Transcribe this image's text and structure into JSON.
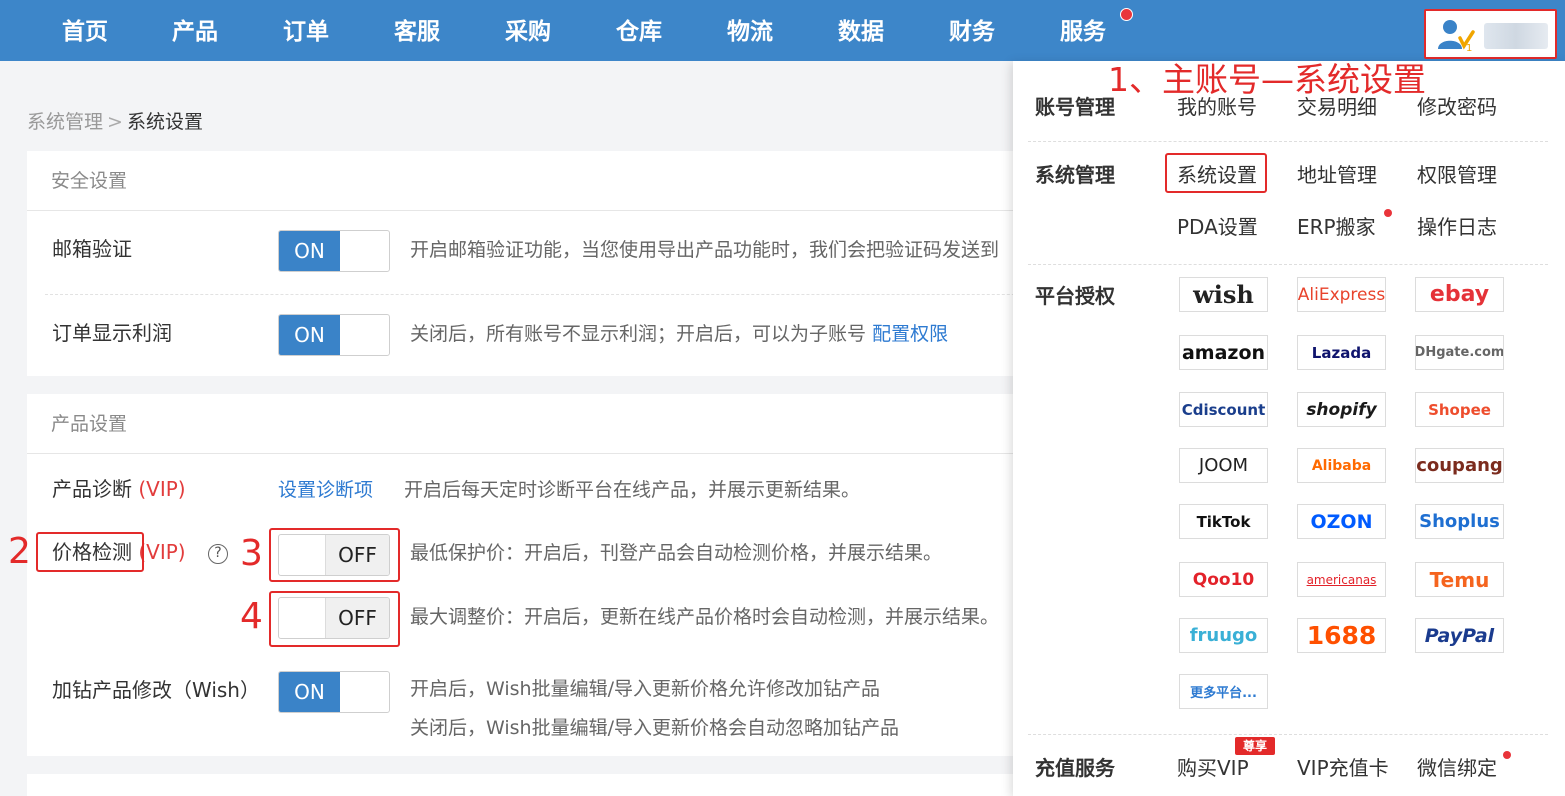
{
  "nav": {
    "items": [
      "首页",
      "产品",
      "订单",
      "客服",
      "采购",
      "仓库",
      "物流",
      "数据",
      "财务",
      "服务"
    ],
    "user_sub": "1"
  },
  "breadcrumb": {
    "root": "系统管理",
    "separator": ">",
    "current": "系统设置"
  },
  "security": {
    "title": "安全设置",
    "email_label": "邮箱验证",
    "email_toggle": "ON",
    "email_desc": "开启邮箱验证功能，当您使用导出产品功能时，我们会把验证码发送到",
    "profit_label": "订单显示利润",
    "profit_toggle": "ON",
    "profit_desc": "关闭后，所有账号不显示利润；开启后，可以为子账号",
    "profit_link": "配置权限"
  },
  "product": {
    "title": "产品设置",
    "diag_label": "产品诊断",
    "diag_vip": "(VIP)",
    "diag_link": "设置诊断项",
    "diag_desc": "开启后每天定时诊断平台在线产品，并展示更新结果。",
    "price_label": "价格检测",
    "price_vip": "(VIP)",
    "help": "?",
    "min_toggle": "OFF",
    "min_desc": "最低保护价：开启后，刊登产品会自动检测价格，并展示结果。",
    "max_toggle": "OFF",
    "max_desc": "最大调整价：开启后，更新在线产品价格时会自动检测，并展示结果。",
    "drill_label": "加钻产品修改（Wish）",
    "drill_toggle": "ON",
    "drill_desc1": "开启后，Wish批量编辑/导入更新价格允许修改加钻产品",
    "drill_desc2": "关闭后，Wish批量编辑/导入更新价格会自动忽略加钻产品"
  },
  "annotations": {
    "step1": "1、主账号—系统设置",
    "step2": "2",
    "step3": "3",
    "step4": "4"
  },
  "menu": {
    "account": {
      "title": "账号管理",
      "items": [
        "我的账号",
        "交易明细",
        "修改密码"
      ]
    },
    "system": {
      "title": "系统管理",
      "items": [
        "系统设置",
        "地址管理",
        "权限管理",
        "PDA设置",
        "ERP搬家",
        "操作日志"
      ]
    },
    "platform": {
      "title": "平台授权",
      "logos": [
        "wish",
        "AliExpress",
        "ebay",
        "amazon",
        "Lazada",
        "DHgate.com",
        "Cdiscount",
        "shopify",
        "Shopee",
        "JOOM",
        "Alibaba",
        "coupang",
        "TikTok",
        "OZON",
        "Shoplus",
        "Qoo10",
        "americanas",
        "Temu",
        "fruugo",
        "1688",
        "PayPal",
        "更多平台..."
      ]
    },
    "recharge": {
      "title": "充值服务",
      "items": [
        "购买VIP",
        "VIP充值卡",
        "微信绑定"
      ],
      "badge": "尊享"
    }
  },
  "colors": {
    "nav_bg": "#3d86c9",
    "accent": "#3a83c8",
    "annotation": "#e32a2a",
    "vip": "#e23c3c"
  }
}
